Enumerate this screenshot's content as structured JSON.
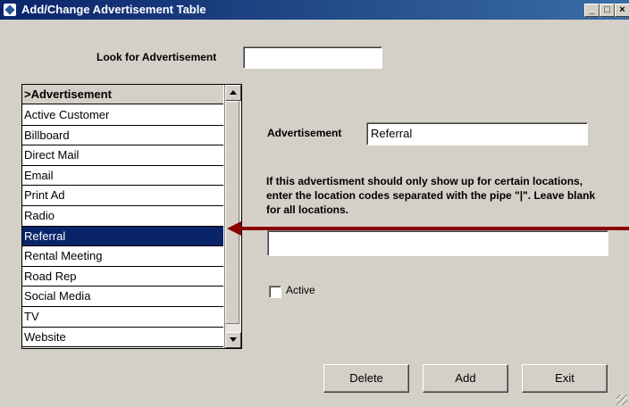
{
  "window": {
    "title": "Add/Change Advertisement Table",
    "minimize": "_",
    "maximize": "□",
    "close": "×"
  },
  "search": {
    "label": "Look for Advertisement",
    "value": ""
  },
  "list": {
    "header": ">Advertisement",
    "items": [
      {
        "label": "Active Customer",
        "selected": false
      },
      {
        "label": "Billboard",
        "selected": false
      },
      {
        "label": "Direct Mail",
        "selected": false
      },
      {
        "label": "Email",
        "selected": false
      },
      {
        "label": "Print Ad",
        "selected": false
      },
      {
        "label": "Radio",
        "selected": false
      },
      {
        "label": "Referral",
        "selected": true
      },
      {
        "label": "Rental Meeting",
        "selected": false
      },
      {
        "label": "Road Rep",
        "selected": false
      },
      {
        "label": "Social Media",
        "selected": false
      },
      {
        "label": "TV",
        "selected": false
      },
      {
        "label": "Website",
        "selected": false
      }
    ]
  },
  "detail": {
    "advertisement_label": "Advertisement",
    "advertisement_value": "Referral",
    "instructions": "If this advertisment should only show up for certain locations, enter the location codes separated with the pipe \"|\". Leave blank for all locations.",
    "locations_value": "",
    "active_label": "Active",
    "active_checked": false
  },
  "buttons": {
    "delete": "Delete",
    "add": "Add",
    "exit": "Exit"
  },
  "colors": {
    "title_bar": "#0a246a",
    "selection": "#0a246a",
    "annotation_arrow": "#8b0000",
    "window_bg": "#d4d0c8"
  }
}
